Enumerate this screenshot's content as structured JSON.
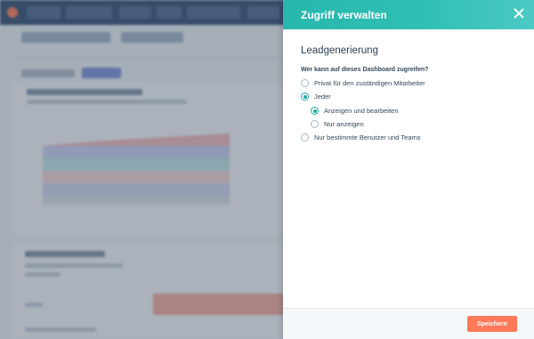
{
  "panel": {
    "title": "Zugriff verwalten",
    "header_color": "#30bfb5",
    "close_icon": "close-icon"
  },
  "section": {
    "title": "Leadgenerierung",
    "question": "Wer kann auf dieses Dashboard zugreifen?"
  },
  "options": [
    {
      "label": "Privat für den zuständigen Mitarbeiter",
      "checked": false
    },
    {
      "label": "Jeder",
      "checked": true
    },
    {
      "label": "Anzeigen und bearbeiten",
      "checked": true
    },
    {
      "label": "Nur anzeigen",
      "checked": false
    },
    {
      "label": "Nur bestimmte Benutzer und Teams",
      "checked": false
    }
  ],
  "footer": {
    "save_label": "Speichern",
    "save_color": "#ff7a59"
  }
}
